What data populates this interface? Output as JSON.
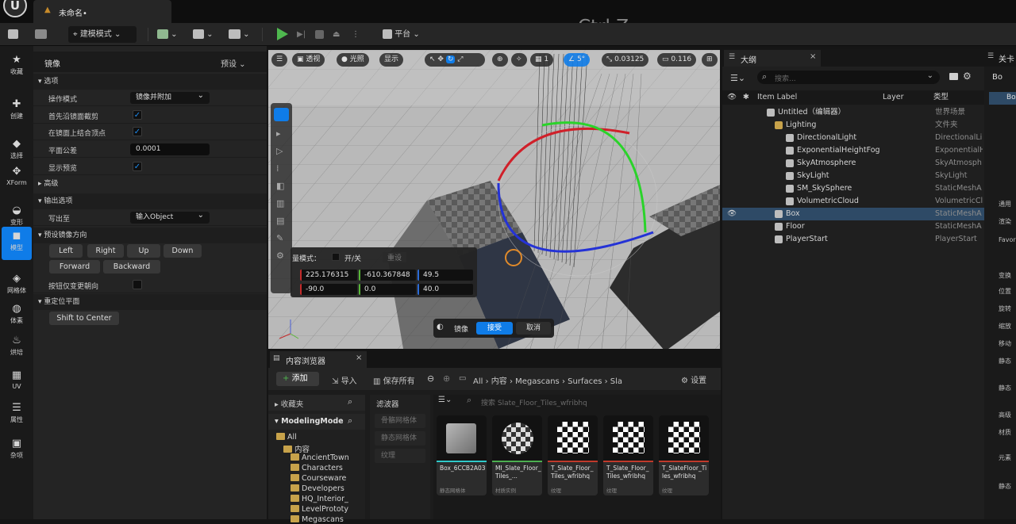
{
  "window": {
    "doc_tab": "未命名•"
  },
  "overlay_text": "Ctrl Z",
  "toolbar": {
    "mode_label": "建模模式",
    "platform_label": "平台",
    "play_color": "#4fb84f"
  },
  "left_toolbar": [
    {
      "label": "收藏",
      "icon": "star-icon"
    },
    {
      "label": "创建",
      "icon": "create-icon"
    },
    {
      "label": "选择",
      "icon": "select-icon"
    },
    {
      "label": "XForm",
      "icon": "xform-icon"
    },
    {
      "label": "变形",
      "icon": "deform-icon"
    },
    {
      "label": "模型",
      "icon": "model-icon"
    },
    {
      "label": "网格体",
      "icon": "mesh-icon"
    },
    {
      "label": "体素",
      "icon": "voxel-icon"
    },
    {
      "label": "烘培",
      "icon": "bake-icon"
    },
    {
      "label": "UV",
      "icon": "uv-icon"
    },
    {
      "label": "属性",
      "icon": "attributes-icon"
    },
    {
      "label": "杂项",
      "icon": "misc-icon"
    }
  ],
  "tool_panel": {
    "title": "镜像",
    "preset": "预设",
    "sections": {
      "options": "选项",
      "advanced": "高级",
      "output": "输出选项",
      "direction": "预设镜像方向",
      "reposition": "重定位平面"
    },
    "operation_mode": {
      "label": "操作模式",
      "value": "镜像并附加"
    },
    "crop_first": {
      "label": "首先沿镜面截剪",
      "checked": true
    },
    "weld": {
      "label": "在镜面上结合顶点",
      "checked": true
    },
    "tolerance": {
      "label": "平面公差",
      "value": "0.0001"
    },
    "preview": {
      "label": "显示预览",
      "checked": true
    },
    "write_to": {
      "label": "写出至",
      "value": "输入Object"
    },
    "dir_buttons": [
      "Left",
      "Right",
      "Up",
      "Down",
      "Forward",
      "Backward"
    ],
    "change_only": {
      "label": "按钮仅变更朝向",
      "checked": false
    },
    "shift_button": "Shift to Center"
  },
  "viewport": {
    "view_mode": "透视",
    "lit_mode": "光照",
    "show": "显示",
    "grid": "1",
    "angle": "5°",
    "scale": "0.03125",
    "camera_speed": "0.116",
    "transform": {
      "mode_label": "量模式：",
      "toggle": "开/关",
      "reset": "重设",
      "location": [
        "225.176315",
        "-610.367848",
        "49.5"
      ],
      "rotation": [
        "-90.0",
        "0.0",
        "40.0"
      ]
    },
    "tool_label": "镜像",
    "accept": "接受",
    "cancel": "取消"
  },
  "outliner": {
    "tab": "大纲",
    "search_placeholder": "搜索...",
    "columns": {
      "label": "Item Label",
      "layer": "Layer",
      "type": "类型"
    },
    "rows": [
      {
        "name": "Untitled（编辑器）",
        "type": "世界场景",
        "depth": 0
      },
      {
        "name": "Lighting",
        "type": "文件夹",
        "depth": 1,
        "folder": true
      },
      {
        "name": "DirectionalLight",
        "type": "DirectionalLi",
        "depth": 2
      },
      {
        "name": "ExponentialHeightFog",
        "type": "ExponentialH",
        "depth": 2
      },
      {
        "name": "SkyAtmosphere",
        "type": "SkyAtmosph",
        "depth": 2
      },
      {
        "name": "SkyLight",
        "type": "SkyLight",
        "depth": 2
      },
      {
        "name": "SM_SkySphere",
        "type": "StaticMeshA",
        "depth": 2
      },
      {
        "name": "VolumetricCloud",
        "type": "VolumetricCl",
        "depth": 2
      },
      {
        "name": "Box",
        "type": "StaticMeshA",
        "depth": 1,
        "selected": true
      },
      {
        "name": "Floor",
        "type": "StaticMeshA",
        "depth": 1
      },
      {
        "name": "PlayerStart",
        "type": "PlayerStart",
        "depth": 1
      }
    ]
  },
  "details_strip": {
    "tab": "关卡",
    "item": "Bo",
    "item2": "Box",
    "labels": [
      "通用",
      "渲染",
      "Favor",
      "变换",
      "位置",
      "旋转",
      "缩放",
      "移动",
      "静态",
      "静态",
      "高级",
      "材质",
      "元素",
      "静态"
    ]
  },
  "content_browser": {
    "tab": "内容浏览器",
    "add": "添加",
    "import": "导入",
    "save_all": "保存所有",
    "settings": "设置",
    "path": [
      "All",
      "内容",
      "Megascans",
      "Surfaces",
      "Sla"
    ],
    "favorites": "收藏夹",
    "project": "ModelingMode",
    "tree": [
      "All",
      "内容",
      "AncientTown",
      "Characters",
      "Courseware",
      "Developers",
      "HQ_Interior_",
      "LevelPrototy",
      "Megascans"
    ],
    "filters_title": "滤波器",
    "filters": [
      "骨骼网格体",
      "静态网格体",
      "纹理"
    ],
    "search_placeholder": "搜索 Slate_Floor_Tiles_wfribhq",
    "assets": [
      {
        "name": "Box_6CCB2A03",
        "type": "静态网格体",
        "kind": "cube",
        "color": "#2fc9c9"
      },
      {
        "name": "MI_Slate_Floor_Tiles_...",
        "type": "材质实例",
        "kind": "sphere",
        "color": "#4caf50"
      },
      {
        "name": "T_Slate_Floor_Tiles_wfribhq",
        "type": "纹理",
        "kind": "tex",
        "color": "#c0392b"
      },
      {
        "name": "T_Slate_Floor_Tiles_wfribhq",
        "type": "纹理",
        "kind": "tex",
        "color": "#c0392b"
      },
      {
        "name": "T_SlateFloor_Tiles_wfribhq",
        "type": "纹理",
        "kind": "tex",
        "color": "#c0392b"
      }
    ]
  }
}
